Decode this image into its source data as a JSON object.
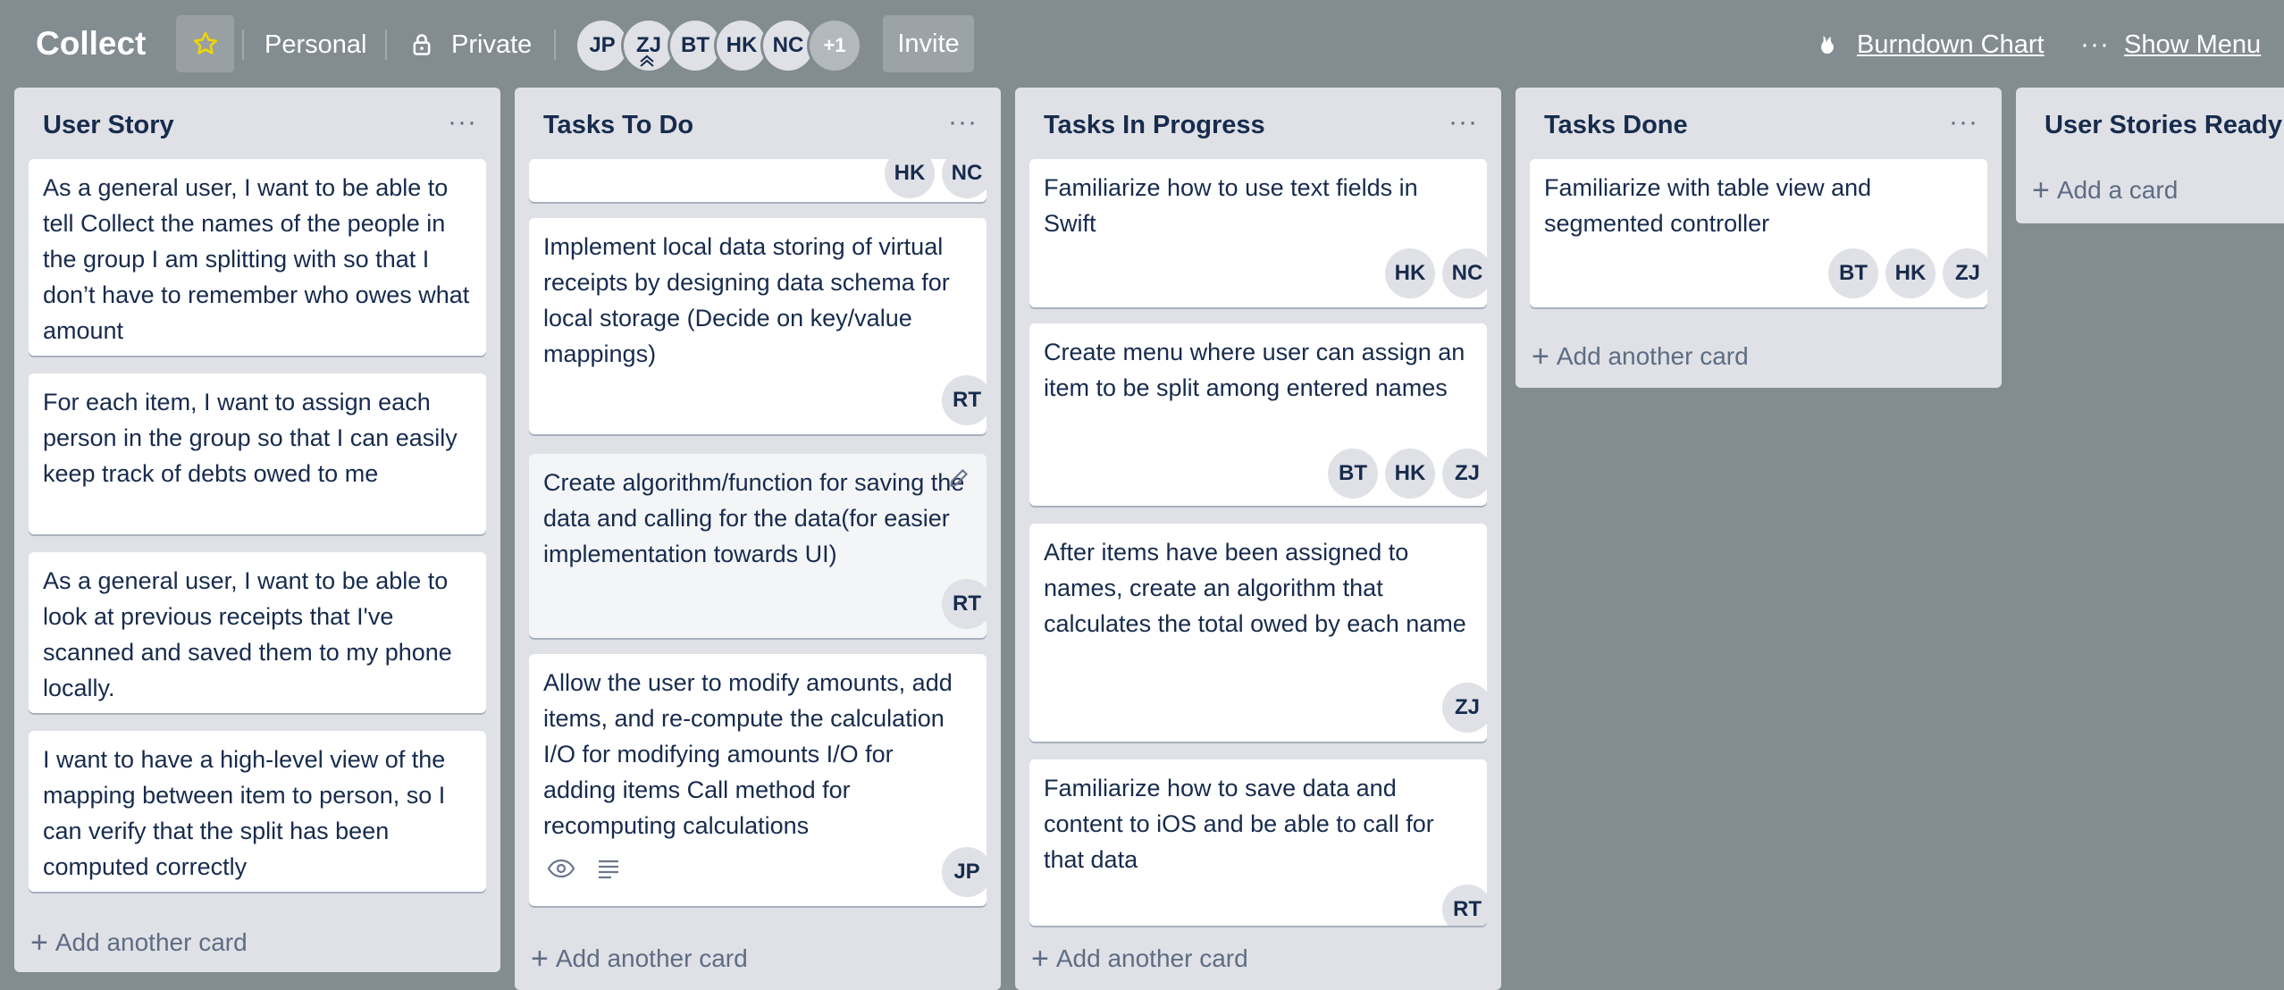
{
  "header": {
    "board_title": "Collect",
    "team": "Personal",
    "visibility": "Private",
    "members": [
      "JP",
      "ZJ",
      "BT",
      "HK",
      "NC"
    ],
    "members_more": "+1",
    "invite_label": "Invite",
    "burndown_label": "Burndown Chart",
    "show_menu_label": "Show Menu"
  },
  "colors": {
    "board_bg": "#838c91",
    "list_bg": "#dfe1e6",
    "card_bg": "#ffffff",
    "text": "#172b4d",
    "muted": "#5e6c84",
    "star": "#f2d600"
  },
  "lists": [
    {
      "title": "User Story",
      "cards": [
        {
          "text": "As a general user, I want to be able to tell Collect the names of the people in the group I am splitting with so that I don’t have to remember who owes what amount",
          "members": []
        },
        {
          "text": "For each item, I want to assign each person in the group so that I can easily keep track of debts owed to me",
          "members": []
        },
        {
          "text": "As a general user, I want to be able to look at previous receipts that I've scanned and saved them to my phone locally.",
          "members": []
        },
        {
          "text": "I want to have a high-level view of the mapping between item to person, so I can verify that the split has been computed correctly",
          "members": []
        }
      ],
      "add_label": "Add another card"
    },
    {
      "title": "Tasks To Do",
      "cards": [
        {
          "text": "",
          "members": [
            "HK",
            "NC"
          ]
        },
        {
          "text": "Implement local data storing of virtual receipts by designing data schema for local storage (Decide on key/value mappings)",
          "members": [
            "RT"
          ]
        },
        {
          "text": "Create algorithm/function for saving the data and calling for the data(for easier implementation towards UI)",
          "members": [
            "RT"
          ]
        },
        {
          "text": "Allow the user to modify amounts, add items, and re-compute the calculation I/O for modifying amounts I/O for adding items Call method for recomputing calculations",
          "members": [
            "JP"
          ]
        }
      ],
      "add_label": "Add another card"
    },
    {
      "title": "Tasks In Progress",
      "cards": [
        {
          "text": "Familiarize how to use text fields in Swift",
          "members": [
            "HK",
            "NC"
          ]
        },
        {
          "text": "Create menu where user can assign an item to be split among entered names",
          "members": [
            "BT",
            "HK",
            "ZJ"
          ]
        },
        {
          "text": "After items have been assigned to names, create an algorithm that calculates the total owed by each name",
          "members": [
            "ZJ"
          ]
        },
        {
          "text": "Familiarize how to save data and content to iOS and be able to call for that data",
          "members": [
            "RT"
          ]
        }
      ],
      "add_label": "Add another card"
    },
    {
      "title": "Tasks Done",
      "cards": [
        {
          "text": "Familiarize with table view and segmented controller",
          "members": [
            "BT",
            "HK",
            "ZJ"
          ]
        }
      ],
      "add_label": "Add another card"
    },
    {
      "title": "User Stories Ready",
      "cards": [],
      "add_label": "Add a card"
    }
  ]
}
